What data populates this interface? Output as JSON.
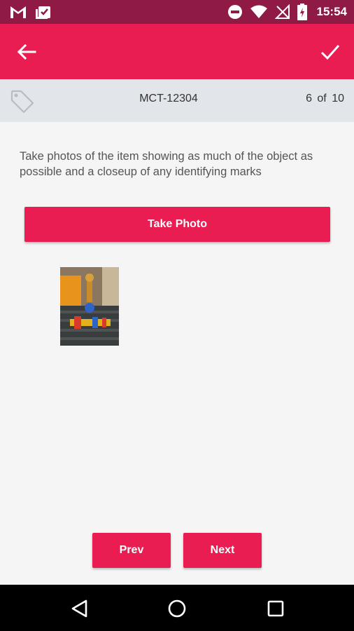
{
  "status_bar": {
    "time": "15:54",
    "left_icons": [
      "gmail-icon",
      "clipboard-check-icon"
    ],
    "right_icons": [
      "do-not-disturb-icon",
      "wifi-icon",
      "no-signal-icon",
      "battery-charging-icon"
    ]
  },
  "app_bar": {
    "back_icon": "arrow-back-icon",
    "confirm_icon": "check-icon",
    "color": "#e91d52"
  },
  "item": {
    "code": "MCT-12304",
    "progress": "6 of 10",
    "icon": "tag-icon"
  },
  "instructions": "Take photos of the item showing as much of the object as possible and a closeup of any identifying marks",
  "buttons": {
    "take_photo": "Take Photo",
    "prev": "Prev",
    "next": "Next"
  },
  "photos": [
    "photo-thumbnail"
  ],
  "nav_bar": [
    "back-triangle-icon",
    "home-circle-icon",
    "recents-square-icon"
  ]
}
